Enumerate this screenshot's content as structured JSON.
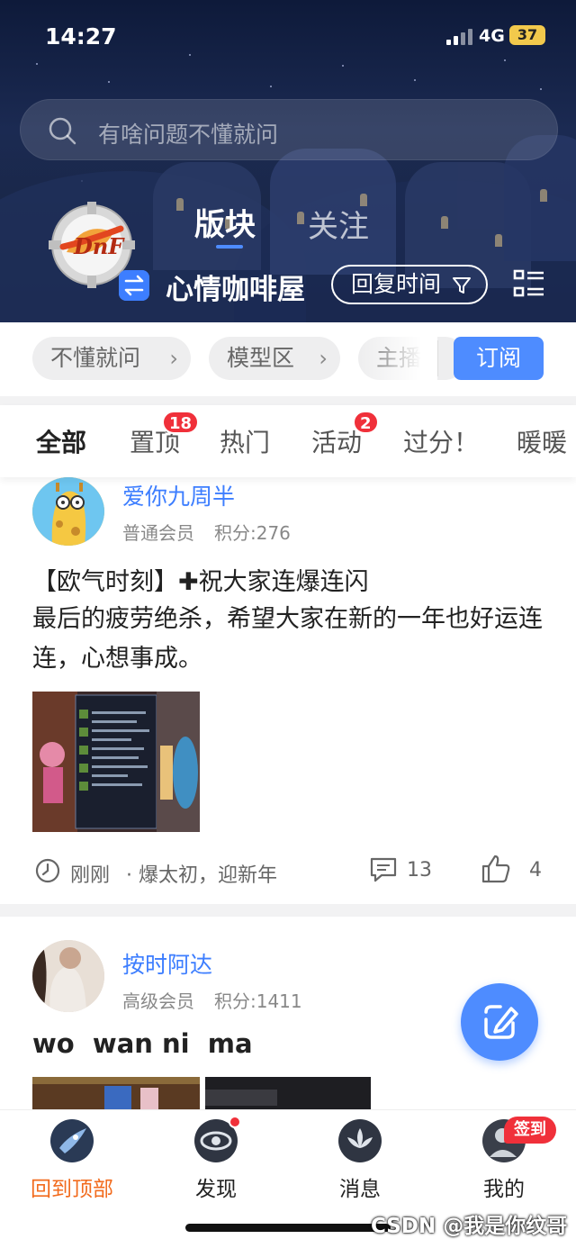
{
  "status_bar": {
    "time": "14:27",
    "network": "4G",
    "battery": "37"
  },
  "search": {
    "placeholder": "有啥问题不懂就问"
  },
  "top_tabs": [
    {
      "label": "版块",
      "active": true
    },
    {
      "label": "关注",
      "active": false
    }
  ],
  "board": {
    "name": "心情咖啡屋",
    "sort_label": "回复时间"
  },
  "sub_sections": [
    {
      "label": "不懂就问"
    },
    {
      "label": "模型区"
    },
    {
      "label": "主播"
    }
  ],
  "subscribe_label": "订阅",
  "categories": [
    {
      "label": "全部",
      "active": true
    },
    {
      "label": "置顶",
      "badge": "18"
    },
    {
      "label": "热门"
    },
    {
      "label": "活动",
      "badge": "2"
    },
    {
      "label": "过分！"
    },
    {
      "label": "暖暖"
    }
  ],
  "posts": [
    {
      "author": "爱你九周半",
      "rank": "普通会员",
      "points": "积分:276",
      "title": "【欧气时刻】✚祝大家连爆连闪",
      "body": "最后的疲劳绝杀，希望大家在新的一年也好运连连，心想事成。",
      "time": "刚刚",
      "tag": "· 爆太初，迎新年",
      "comments": "13",
      "likes": "4"
    },
    {
      "author": "按时阿达",
      "rank": "高级会员",
      "points": "积分:1411",
      "title": "wo  wan ni  ma"
    }
  ],
  "bottom_nav": [
    {
      "label": "回到顶部",
      "icon": "rocket-icon",
      "active": true
    },
    {
      "label": "发现",
      "icon": "eye-icon"
    },
    {
      "label": "消息",
      "icon": "lotus-icon"
    },
    {
      "label": "我的",
      "icon": "profile-avatar-icon"
    }
  ],
  "checkin_badge": "签到",
  "watermark": "CSDN @我是你纹哥",
  "colors": {
    "accent": "#4e8cff",
    "badge_red": "#f0303a",
    "active_nav": "#f26b1d"
  }
}
